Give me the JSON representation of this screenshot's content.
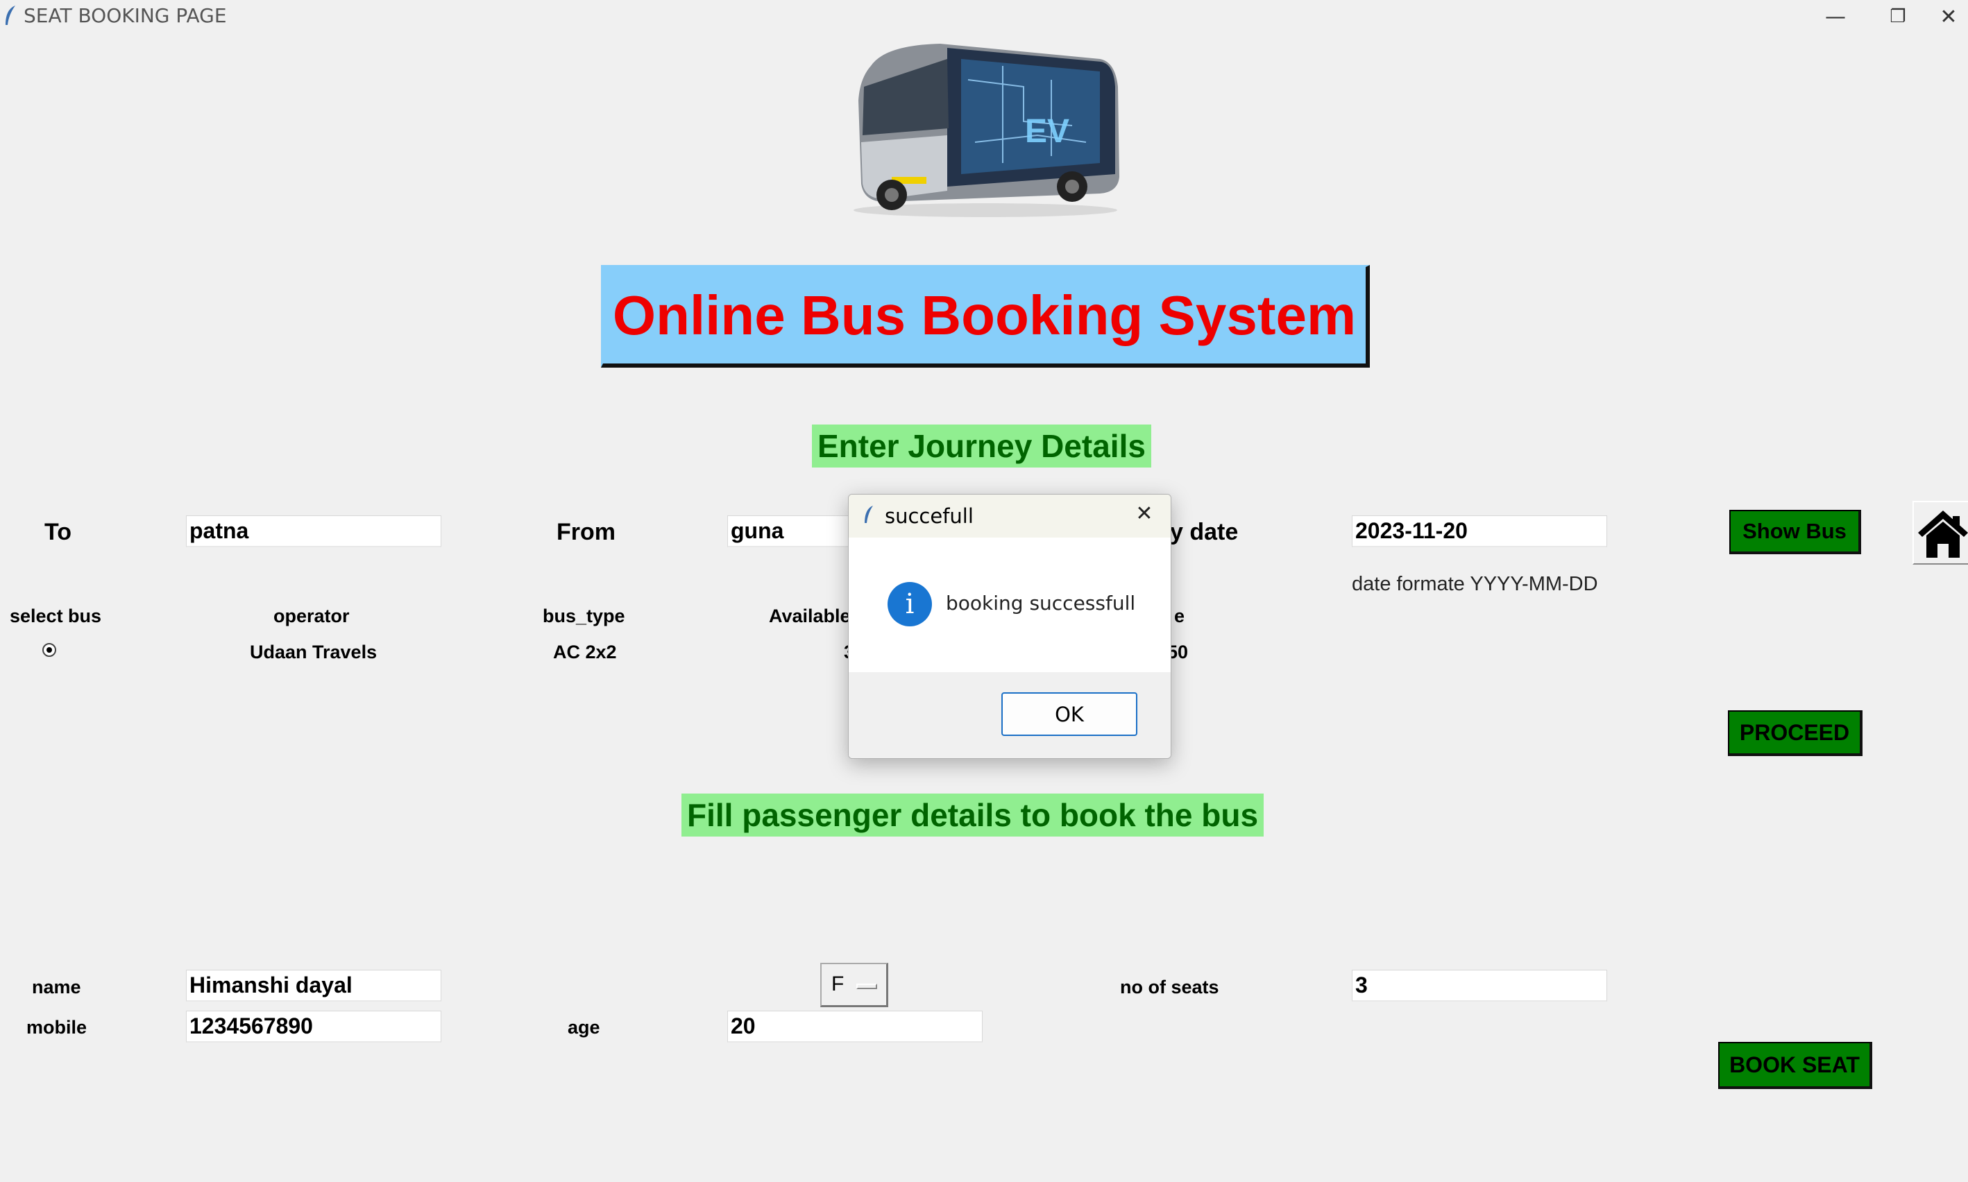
{
  "window": {
    "title": "SEAT BOOKING PAGE",
    "minimize": "—",
    "restore": "❐",
    "close": "✕"
  },
  "banner": {
    "title": "Online Bus Booking System"
  },
  "journey": {
    "heading": "Enter Journey Details",
    "to_label": "To",
    "to_value": "patna",
    "from_label": "From",
    "from_value": "guna",
    "date_label_visible": "y date",
    "date_value": "2023-11-20",
    "date_hint": "date formate YYYY-MM-DD",
    "show_bus_label": "Show Bus"
  },
  "bus_table": {
    "headers": [
      "select bus",
      "operator",
      "bus_type",
      "Available",
      "e"
    ],
    "row": {
      "operator": "Udaan Travels",
      "bus_type": "AC 2x2",
      "available": "3",
      "fare": "50",
      "selected": true
    }
  },
  "proceed_label": "PROCEED",
  "passenger": {
    "heading": "Fill passenger details to book the bus",
    "name_label": "name",
    "name_value": "Himanshi dayal",
    "gender_value": "F",
    "seats_label": "no of seats",
    "seats_value": "3",
    "mobile_label": "mobile",
    "mobile_value": "1234567890",
    "age_label": "age",
    "age_value": "20",
    "book_label": "BOOK SEAT"
  },
  "dialog": {
    "title": "succefull",
    "message": "booking successfull",
    "ok_label": "OK",
    "info_glyph": "i",
    "close_glyph": "✕"
  },
  "icons": {
    "home": "home-icon",
    "app": "feather-icon",
    "info": "info-icon"
  },
  "colors": {
    "banner_bg": "#87cefa",
    "banner_text": "#ee0000",
    "heading_bg": "#90ee90",
    "heading_text": "#006400",
    "button_bg": "#008000"
  }
}
